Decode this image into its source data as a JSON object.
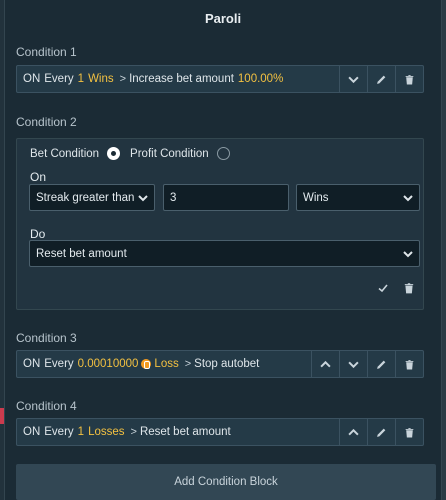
{
  "modal": {
    "title": "Paroli"
  },
  "conditions": [
    {
      "label": "Condition 1",
      "on": "ON",
      "every": "Every",
      "count": "1",
      "event": "Wins",
      "action": "Increase bet amount",
      "amount": "100.00%"
    },
    {
      "label": "Condition 2",
      "radio_bet": "Bet Condition",
      "radio_profit": "Profit Condition",
      "selected": "bet",
      "on_label": "On",
      "on_select": "Streak greater than",
      "on_value": "3",
      "on_unit": "Wins",
      "do_label": "Do",
      "do_select": "Reset bet amount"
    },
    {
      "label": "Condition 3",
      "on": "ON",
      "every": "Every",
      "amount": "0.00010000",
      "event": "Loss",
      "action": "Stop autobet"
    },
    {
      "label": "Condition 4",
      "on": "ON",
      "every": "Every",
      "count": "1",
      "event": "Losses",
      "action": "Reset bet amount"
    }
  ],
  "add_button": "Add Condition Block",
  "colors": {
    "accent": "#f3c141",
    "bitcoin": "#f39a1e",
    "bg": "#1b2b35"
  }
}
